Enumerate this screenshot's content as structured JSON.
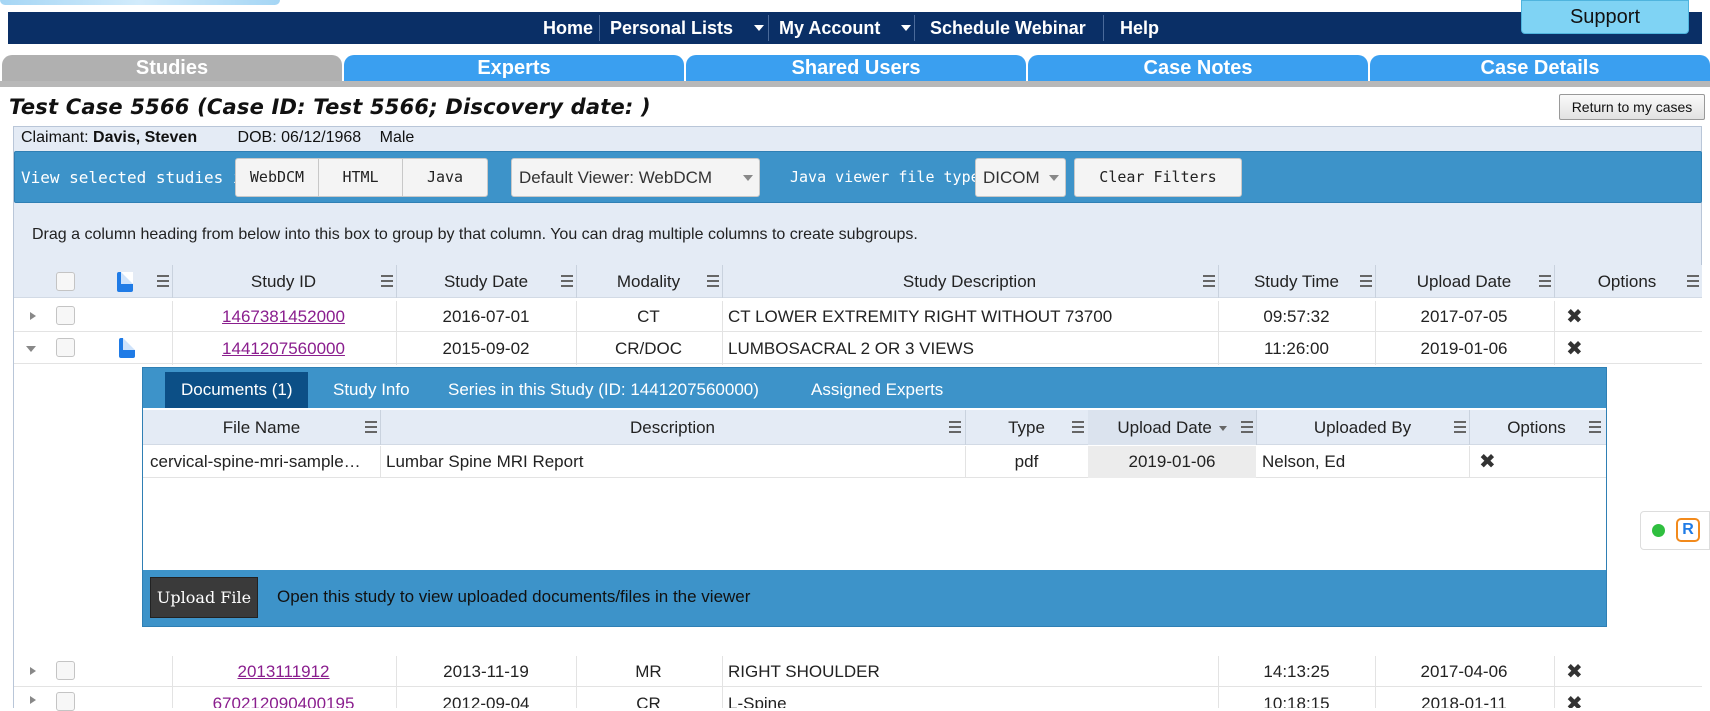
{
  "nav": {
    "items": [
      "Home",
      "Personal Lists",
      "My Account",
      "Schedule Webinar",
      "Help"
    ],
    "support_label": "Support"
  },
  "tabs": [
    "Studies",
    "Experts",
    "Shared Users",
    "Case Notes",
    "Case Details"
  ],
  "active_tab": "Studies",
  "case": {
    "title": "Test Case 5566 (Case ID: Test 5566; Discovery date: )",
    "return_label": "Return to my cases",
    "claimant_label": "Claimant:",
    "claimant_name": "Davis, Steven",
    "dob": "DOB: 06/12/1968",
    "sex": "Male"
  },
  "viewer_bar": {
    "label": "View selected studies in:",
    "buttons": [
      "WebDCM",
      "HTML",
      "Java"
    ],
    "default_viewer": "Default Viewer: WebDCM",
    "java_label": "Java viewer file type:",
    "java_type": "DICOM",
    "clear_filters": "Clear Filters"
  },
  "group_hint": "Drag a column heading from below into this box to group by that column. You can drag multiple columns to create subgroups.",
  "grid": {
    "columns": [
      "Study ID",
      "Study Date",
      "Modality",
      "Study Description",
      "Study Time",
      "Upload Date",
      "Options"
    ],
    "rows": [
      {
        "id": "1467381452000",
        "date": "2016-07-01",
        "modality": "CT",
        "desc": "CT LOWER EXTREMITY RIGHT WITHOUT 73700",
        "time": "09:57:32",
        "upload": "2017-07-05"
      },
      {
        "id": "1441207560000",
        "date": "2015-09-02",
        "modality": "CR/DOC",
        "desc": "LUMBOSACRAL 2 OR 3 VIEWS",
        "time": "11:26:00",
        "upload": "2019-01-06"
      },
      {
        "id": "2013111912",
        "date": "2013-11-19",
        "modality": "MR",
        "desc": "RIGHT SHOULDER",
        "time": "14:13:25",
        "upload": "2017-04-06"
      },
      {
        "id": "670212090400195",
        "date": "2012-09-04",
        "modality": "CR",
        "desc": "L-Spine",
        "time": "10:18:15",
        "upload": "2018-01-11"
      }
    ]
  },
  "detail": {
    "tabs": [
      "Documents (1)",
      "Study Info",
      "Series in this Study (ID: 1441207560000)",
      "Assigned Experts"
    ],
    "columns": [
      "File Name",
      "Description",
      "Type",
      "Upload Date",
      "Uploaded By",
      "Options"
    ],
    "row": {
      "file": "cervical-spine-mri-sample…",
      "desc": "Lumbar Spine MRI Report",
      "type": "pdf",
      "upload": "2019-01-06",
      "by": "Nelson, Ed"
    },
    "upload_label": "Upload File",
    "open_hint": "Open this study to view uploaded documents/files in the viewer"
  },
  "colors": {
    "navy": "#0a2f66",
    "tab_blue": "#3a9ff0",
    "tab_gray": "#b0b0b0",
    "bar_blue": "#3d93c9",
    "link": "#8a1e8e"
  }
}
